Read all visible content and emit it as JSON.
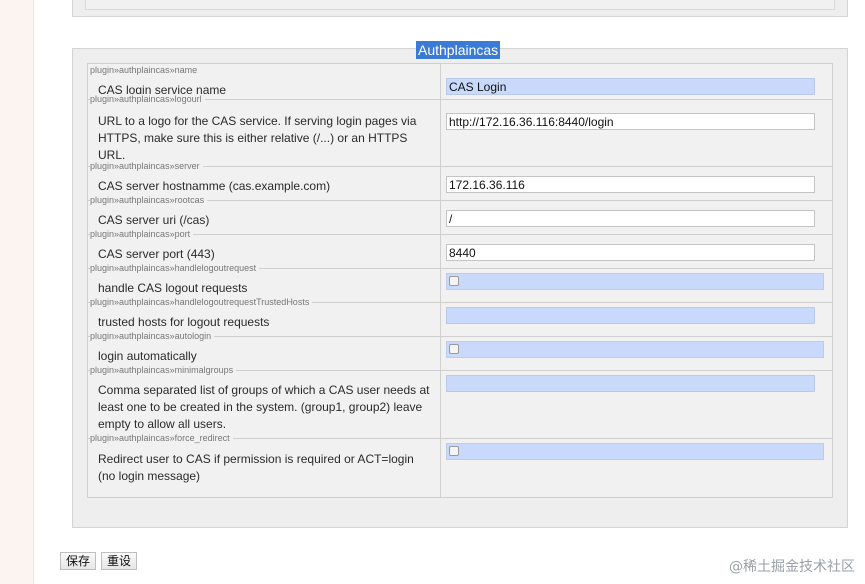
{
  "section": {
    "title": "Authplaincas"
  },
  "settings": [
    {
      "key": "plugin»authplaincas»name",
      "desc": "CAS login service name",
      "type": "text",
      "value": "CAS Login",
      "highlight": true
    },
    {
      "key": "plugin»authplaincas»logourl",
      "desc": "URL to a logo for the CAS service. If serving login pages via HTTPS, make sure this is either relative (/...) or an HTTPS URL.",
      "type": "text",
      "value": "http://172.16.36.116:8440/login",
      "highlight": false
    },
    {
      "key": "plugin»authplaincas»server",
      "desc": "CAS server hostnamme (cas.example.com)",
      "type": "text",
      "value": "172.16.36.116",
      "highlight": false
    },
    {
      "key": "plugin»authplaincas»rootcas",
      "desc": "CAS server uri (/cas)",
      "type": "text",
      "value": "/",
      "highlight": false
    },
    {
      "key": "plugin»authplaincas»port",
      "desc": "CAS server port (443)",
      "type": "text",
      "value": "8440",
      "highlight": false
    },
    {
      "key": "plugin»authplaincas»handlelogoutrequest",
      "desc": "handle CAS logout requests",
      "type": "checkbox",
      "checked": false
    },
    {
      "key": "plugin»authplaincas»handlelogoutrequestTrustedHosts",
      "desc": "trusted hosts for logout requests",
      "type": "text",
      "value": "",
      "highlight": true
    },
    {
      "key": "plugin»authplaincas»autologin",
      "desc": "login automatically",
      "type": "checkbox",
      "checked": false
    },
    {
      "key": "plugin»authplaincas»minimalgroups",
      "desc": "Comma separated list of groups of which a CAS user needs at least one to be created in the system. (group1, group2) leave empty to allow all users.",
      "type": "text",
      "value": "",
      "highlight": true
    },
    {
      "key": "plugin»authplaincas»force_redirect",
      "desc": "Redirect user to CAS if permission is required or ACT=login (no login message)",
      "type": "checkbox",
      "checked": false
    }
  ],
  "buttons": {
    "save": "保存",
    "reset": "重设"
  },
  "watermark": "@稀土掘金技术社区"
}
